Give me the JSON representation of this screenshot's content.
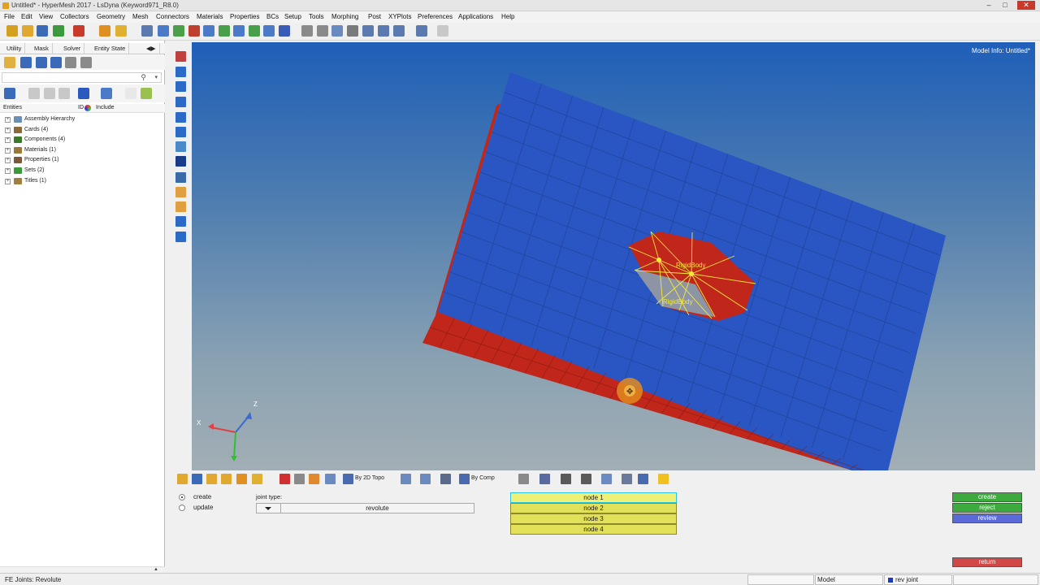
{
  "window": {
    "title": "Untitled* - HyperMesh 2017 - LsDyna (Keyword971_R8.0)"
  },
  "menu": [
    "File",
    "Edit",
    "View",
    "Collectors",
    "Geometry",
    "Mesh",
    "Connectors",
    "Materials",
    "Properties",
    "BCs",
    "Setup",
    "Tools",
    "Morphing",
    "Post",
    "XYPlots",
    "Preferences",
    "Applications",
    "Help"
  ],
  "browser": {
    "tabs": [
      "Utility",
      "Mask",
      "Solver",
      "Entity State"
    ],
    "columns": {
      "entities": "Entities",
      "id": "ID",
      "include": "Include"
    },
    "tree": [
      {
        "label": "Assembly Hierarchy",
        "color": "#6a8fb5"
      },
      {
        "label": "Cards (4)",
        "color": "#8a6a3a"
      },
      {
        "label": "Components (4)",
        "color": "#3a7a2a"
      },
      {
        "label": "Materials (1)",
        "color": "#9a7a3a"
      },
      {
        "label": "Properties (1)",
        "color": "#7a5a3a"
      },
      {
        "label": "Sets (2)",
        "color": "#3a9a3a"
      },
      {
        "label": "Titles (1)",
        "color": "#a08040"
      }
    ]
  },
  "viewport": {
    "model_info": "Model Info: Untitled*",
    "labels": {
      "rigid1": "RigidBody",
      "rigid2": "RigidBody"
    },
    "axis": {
      "z": "Z",
      "x": "X"
    }
  },
  "bottom_toolbar": {
    "topo_label": "By 2D Topo",
    "comp_label": "By Comp"
  },
  "panel": {
    "modes": {
      "create": "create",
      "update": "update"
    },
    "joint_type_label": "joint type:",
    "joint_type_value": "revolute",
    "nodes": [
      "node 1",
      "node 2",
      "node 3",
      "node 4"
    ],
    "actions": {
      "create": "create",
      "reject": "reject",
      "review": "review",
      "return": "return"
    }
  },
  "status": {
    "left": "FE Joints: Revolute",
    "model": "Model",
    "collector": "rev joint"
  },
  "colors": {
    "plate": "#2956c2",
    "flange": "#c0261a",
    "highlight": "#f2ea3a"
  }
}
